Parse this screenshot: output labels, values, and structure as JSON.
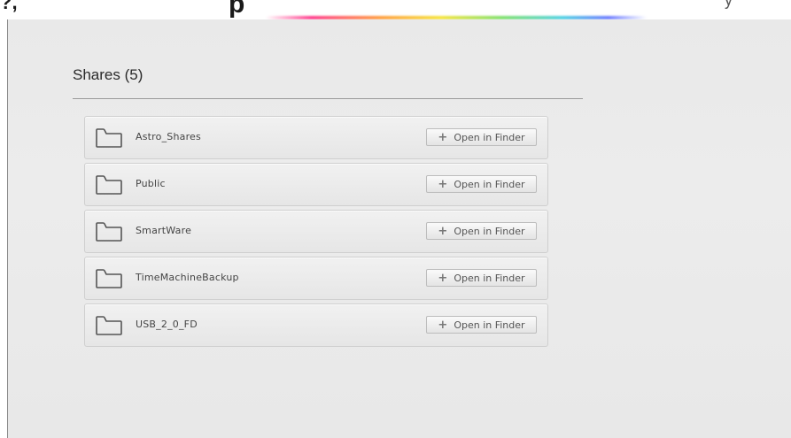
{
  "top_fragment": {
    "left_mark": "?,",
    "glyph": "p",
    "right_mark": "y"
  },
  "section": {
    "title": "Shares (5)"
  },
  "shares": [
    {
      "name": "Astro_Shares",
      "action_label": "Open in Finder",
      "icon": "folder-icon"
    },
    {
      "name": "Public",
      "action_label": "Open in Finder",
      "icon": "folder-icon"
    },
    {
      "name": "SmartWare",
      "action_label": "Open in Finder",
      "icon": "folder-icon"
    },
    {
      "name": "TimeMachineBackup",
      "action_label": "Open in Finder",
      "icon": "folder-icon"
    },
    {
      "name": "USB_2_0_FD",
      "action_label": "Open in Finder",
      "icon": "folder-icon"
    }
  ],
  "colors": {
    "background": "#e9e9e9",
    "text": "#444444",
    "rule": "#9a9a9a"
  }
}
